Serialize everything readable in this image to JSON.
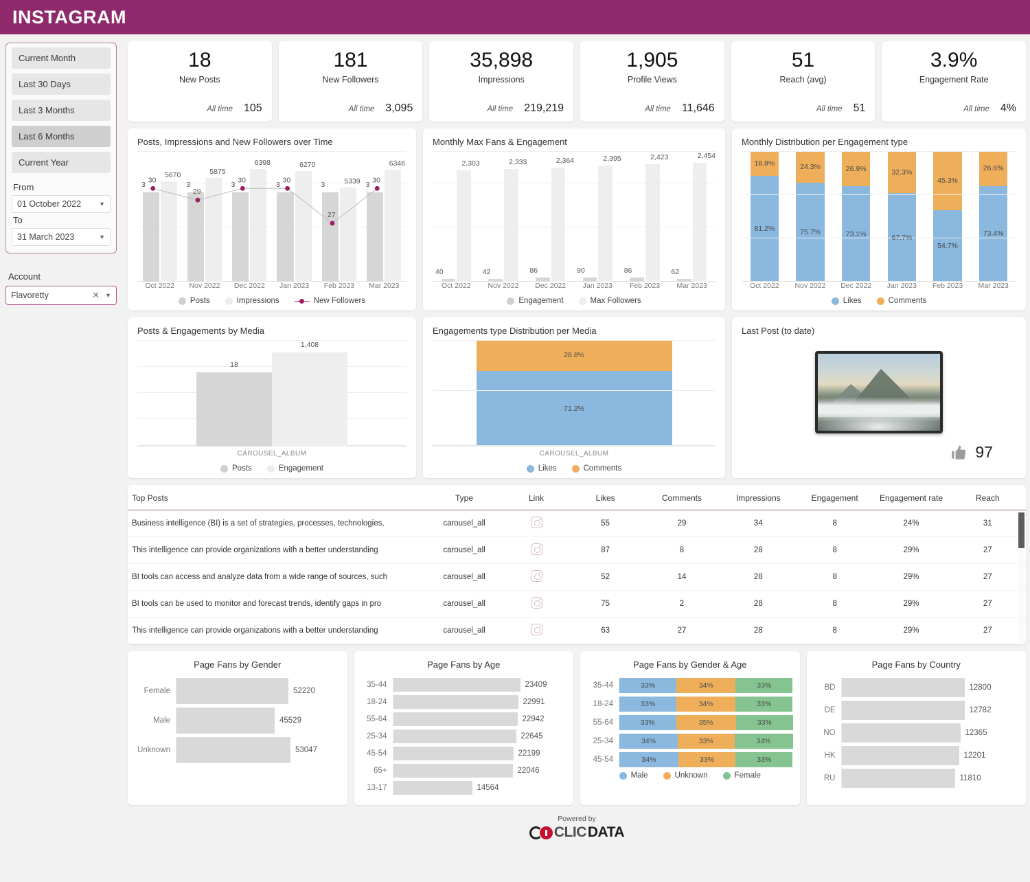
{
  "header": {
    "title": "INSTAGRAM",
    "brand_color": "#8e2a6b"
  },
  "sidebar": {
    "periods": [
      {
        "label": "Current Month",
        "active": false
      },
      {
        "label": "Last 30 Days",
        "active": false
      },
      {
        "label": "Last 3 Months",
        "active": false
      },
      {
        "label": "Last 6 Months",
        "active": true
      },
      {
        "label": "Current Year",
        "active": false
      }
    ],
    "from_label": "From",
    "from_value": "01 October 2022",
    "to_label": "To",
    "to_value": "31 March 2023",
    "account_label": "Account",
    "account_value": "Flavoretty"
  },
  "kpis": [
    {
      "value": "18",
      "label": "New Posts",
      "alltime_label": "All time",
      "alltime_value": "105"
    },
    {
      "value": "181",
      "label": "New Followers",
      "alltime_label": "All time",
      "alltime_value": "3,095"
    },
    {
      "value": "35,898",
      "label": "Impressions",
      "alltime_label": "All time",
      "alltime_value": "219,219"
    },
    {
      "value": "1,905",
      "label": "Profile Views",
      "alltime_label": "All time",
      "alltime_value": "11,646"
    },
    {
      "value": "51",
      "label": "Reach (avg)",
      "alltime_label": "All time",
      "alltime_value": "51"
    },
    {
      "value": "3.9%",
      "label": "Engagement Rate",
      "alltime_label": "All time",
      "alltime_value": "4%"
    }
  ],
  "chart_data": [
    {
      "id": "posts_impressions_followers",
      "type": "bar",
      "title": "Posts, Impressions and New Followers over Time",
      "categories": [
        "Oct 2022",
        "Nov 2022",
        "Dec 2022",
        "Jan 2023",
        "Feb 2023",
        "Mar 2023"
      ],
      "series": [
        {
          "name": "Posts",
          "type": "bar",
          "color": "#d6d6d6",
          "values": [
            3,
            3,
            3,
            3,
            3,
            3
          ]
        },
        {
          "name": "Impressions",
          "type": "bar",
          "color": "#eeeeee",
          "values": [
            5670,
            5875,
            6398,
            6270,
            5339,
            6346
          ]
        },
        {
          "name": "New Followers",
          "type": "line",
          "color": "#9c1f62",
          "values": [
            30,
            29,
            30,
            30,
            27,
            30
          ]
        }
      ],
      "legend": [
        "Posts",
        "Impressions",
        "New Followers"
      ],
      "grid": true
    },
    {
      "id": "monthly_max_fans_engagement",
      "type": "bar",
      "title": "Monthly Max Fans & Engagement",
      "categories": [
        "Oct 2022",
        "Nov 2022",
        "Dec 2022",
        "Jan 2023",
        "Feb 2023",
        "Mar 2023"
      ],
      "series": [
        {
          "name": "Engagement",
          "color": "#d6d6d6",
          "values": [
            40,
            42,
            86,
            90,
            86,
            62
          ]
        },
        {
          "name": "Max Followers",
          "color": "#eeeeee",
          "values": [
            2303,
            2333,
            2364,
            2395,
            2423,
            2454
          ],
          "value_labels": [
            "2,303",
            "2,333",
            "2,364",
            "2,395",
            "2,423",
            "2,454"
          ]
        }
      ],
      "legend": [
        "Engagement",
        "Max Followers"
      ],
      "grid": true
    },
    {
      "id": "monthly_distribution_engagement_type",
      "type": "bar",
      "stacked": true,
      "title": "Monthly Distribution per Engagement type",
      "categories": [
        "Oct 2022",
        "Nov 2022",
        "Dec 2022",
        "Jan 2023",
        "Feb 2023",
        "Mar 2023"
      ],
      "series": [
        {
          "name": "Likes",
          "color": "#8ab8de",
          "values": [
            81.2,
            75.7,
            73.1,
            67.7,
            54.7,
            73.4
          ],
          "value_labels": [
            "81.2%",
            "75.7%",
            "73.1%",
            "67.7%",
            "54.7%",
            "73.4%"
          ]
        },
        {
          "name": "Comments",
          "color": "#efaf5a",
          "values": [
            18.8,
            24.3,
            26.9,
            32.3,
            45.3,
            26.6
          ],
          "value_labels": [
            "18.8%",
            "24.3%",
            "26.9%",
            "32.3%",
            "45.3%",
            "26.6%"
          ]
        }
      ],
      "legend": [
        "Likes",
        "Comments"
      ],
      "ylim": [
        0,
        100
      ]
    },
    {
      "id": "posts_engagements_by_media",
      "type": "bar",
      "title": "Posts & Engagements by Media",
      "categories": [
        "CAROUSEL_ALBUM"
      ],
      "series": [
        {
          "name": "Posts",
          "color": "#d6d6d6",
          "values": [
            18
          ],
          "value_labels": [
            "18"
          ]
        },
        {
          "name": "Engagement",
          "color": "#eeeeee",
          "values": [
            1408
          ],
          "value_labels": [
            "1,408"
          ]
        }
      ],
      "legend": [
        "Posts",
        "Engagement"
      ]
    },
    {
      "id": "engagements_type_distribution_per_media",
      "type": "bar",
      "stacked": true,
      "title": "Engagements type Distribution per Media",
      "categories": [
        "CAROUSEL_ALBUM"
      ],
      "series": [
        {
          "name": "Likes",
          "color": "#8ab8de",
          "values": [
            71.2
          ],
          "value_labels": [
            "71.2%"
          ]
        },
        {
          "name": "Comments",
          "color": "#efaf5a",
          "values": [
            28.8
          ],
          "value_labels": [
            "28.8%"
          ]
        }
      ],
      "legend": [
        "Likes",
        "Comments"
      ],
      "ylim": [
        0,
        100
      ]
    },
    {
      "id": "page_fans_by_gender",
      "type": "bar",
      "orientation": "horizontal",
      "title": "Page Fans by Gender",
      "categories": [
        "Female",
        "Male",
        "Unknown"
      ],
      "values": [
        52220,
        45529,
        53047
      ],
      "value_labels": [
        "52220",
        "45529",
        "53047"
      ]
    },
    {
      "id": "page_fans_by_age",
      "type": "bar",
      "orientation": "horizontal",
      "title": "Page Fans by Age",
      "categories": [
        "35-44",
        "18-24",
        "55-64",
        "25-34",
        "45-54",
        "65+",
        "13-17"
      ],
      "values": [
        23409,
        22991,
        22942,
        22645,
        22199,
        22046,
        14564
      ],
      "value_labels": [
        "23409",
        "22991",
        "22942",
        "22645",
        "22199",
        "22046",
        "14564"
      ]
    },
    {
      "id": "page_fans_by_gender_age",
      "type": "bar",
      "orientation": "horizontal",
      "stacked": true,
      "title": "Page Fans by Gender & Age",
      "categories": [
        "35-44",
        "18-24",
        "55-64",
        "25-34",
        "45-54"
      ],
      "series": [
        {
          "name": "Male",
          "color": "#8ab8de",
          "values": [
            33,
            33,
            33,
            34,
            34
          ],
          "value_labels": [
            "33%",
            "33%",
            "33%",
            "34%",
            "34%"
          ]
        },
        {
          "name": "Unknown",
          "color": "#efaf5a",
          "values": [
            34,
            34,
            35,
            33,
            33
          ],
          "value_labels": [
            "34%",
            "34%",
            "35%",
            "33%",
            "33%"
          ]
        },
        {
          "name": "Female",
          "color": "#85c490",
          "values": [
            33,
            33,
            33,
            34,
            33
          ],
          "value_labels": [
            "33%",
            "33%",
            "33%",
            "34%",
            "33%"
          ]
        }
      ],
      "legend": [
        "Male",
        "Unknown",
        "Female"
      ]
    },
    {
      "id": "page_fans_by_country",
      "type": "bar",
      "orientation": "horizontal",
      "title": "Page Fans by Country",
      "categories": [
        "BD",
        "DE",
        "NO",
        "HK",
        "RU"
      ],
      "values": [
        12800,
        12782,
        12365,
        12201,
        11810
      ],
      "value_labels": [
        "12800",
        "12782",
        "12365",
        "12201",
        "11810"
      ]
    }
  ],
  "last_post": {
    "title": "Last Post (to date)",
    "likes": "97",
    "like_icon": "thumbs-up-icon"
  },
  "table": {
    "headers": [
      "Top Posts",
      "Type",
      "Link",
      "Likes",
      "Comments",
      "Impressions",
      "Engagement",
      "Engagement rate",
      "Reach"
    ],
    "rows": [
      {
        "post": "Business intelligence (BI) is a set of strategies, processes, technologies,",
        "type": "carousel_all",
        "link_icon": "instagram-icon",
        "likes": "55",
        "comments": "29",
        "impressions": "34",
        "engagement": "8",
        "engagement_rate": "24%",
        "reach": "31"
      },
      {
        "post": "This intelligence can provide organizations with a better understanding",
        "type": "carousel_all",
        "link_icon": "instagram-icon",
        "likes": "87",
        "comments": "8",
        "impressions": "28",
        "engagement": "8",
        "engagement_rate": "29%",
        "reach": "27"
      },
      {
        "post": "BI tools can access and analyze data from a wide range of sources, such",
        "type": "carousel_all",
        "link_icon": "instagram-icon",
        "likes": "52",
        "comments": "14",
        "impressions": "28",
        "engagement": "8",
        "engagement_rate": "29%",
        "reach": "27"
      },
      {
        "post": "BI tools can be used to monitor and forecast trends, identify gaps in pro",
        "type": "carousel_all",
        "link_icon": "instagram-icon",
        "likes": "75",
        "comments": "2",
        "impressions": "28",
        "engagement": "8",
        "engagement_rate": "29%",
        "reach": "27"
      },
      {
        "post": "This intelligence can provide organizations with a better understanding",
        "type": "carousel_all",
        "link_icon": "instagram-icon",
        "likes": "63",
        "comments": "27",
        "impressions": "28",
        "engagement": "8",
        "engagement_rate": "29%",
        "reach": "27"
      }
    ]
  },
  "footer": {
    "powered_by": "Powered by",
    "logo_part1": "CLIC",
    "logo_part2": "DATA"
  }
}
